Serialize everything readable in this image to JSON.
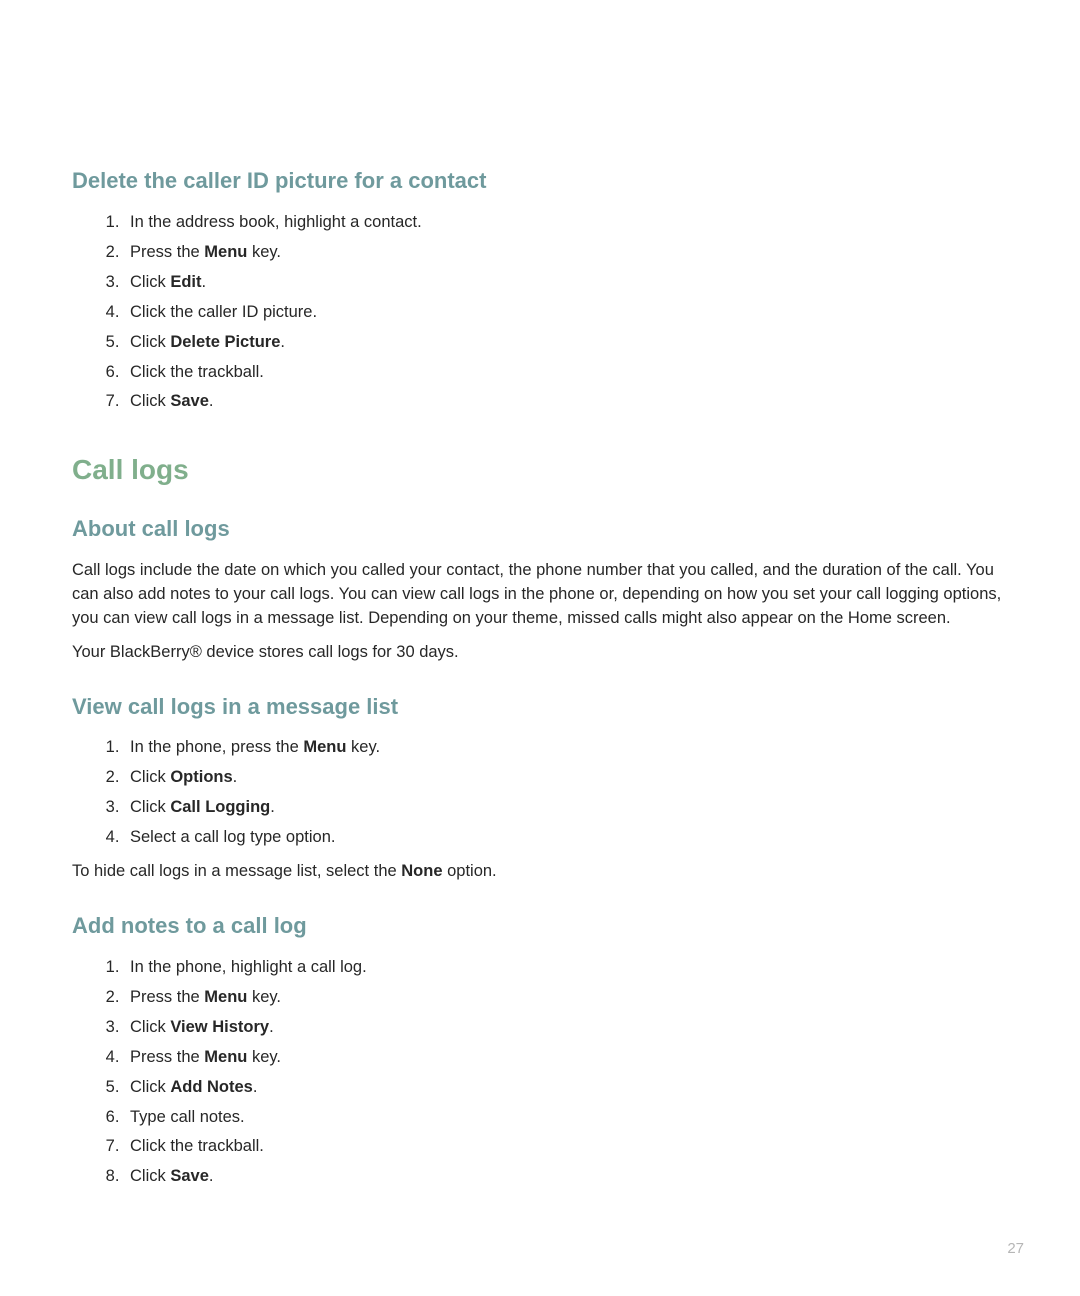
{
  "page_number": "27",
  "section1": {
    "heading": "Delete the caller ID picture for a contact",
    "steps": [
      [
        {
          "t": "In the address book, highlight a contact."
        }
      ],
      [
        {
          "t": "Press the "
        },
        {
          "t": "Menu",
          "b": true
        },
        {
          "t": " key."
        }
      ],
      [
        {
          "t": "Click "
        },
        {
          "t": "Edit",
          "b": true
        },
        {
          "t": "."
        }
      ],
      [
        {
          "t": "Click the caller ID picture."
        }
      ],
      [
        {
          "t": "Click "
        },
        {
          "t": "Delete Picture",
          "b": true
        },
        {
          "t": "."
        }
      ],
      [
        {
          "t": "Click the trackball."
        }
      ],
      [
        {
          "t": "Click "
        },
        {
          "t": "Save",
          "b": true
        },
        {
          "t": "."
        }
      ]
    ]
  },
  "section2": {
    "heading": "Call logs"
  },
  "section3": {
    "heading": "About call logs",
    "paragraphs": [
      [
        {
          "t": "Call logs include the date on which you called your contact, the phone number that you called, and the duration of the call. You can also add notes to your call logs. You can view call logs in the phone or, depending on how you set your call logging options, you can view call logs in a message list. Depending on your theme, missed calls might also appear on the Home screen."
        }
      ],
      [
        {
          "t": "Your BlackBerry® device stores call logs for 30 days."
        }
      ]
    ]
  },
  "section4": {
    "heading": "View call logs in a message list",
    "steps": [
      [
        {
          "t": "In the phone, press the "
        },
        {
          "t": "Menu",
          "b": true
        },
        {
          "t": " key."
        }
      ],
      [
        {
          "t": "Click "
        },
        {
          "t": "Options",
          "b": true
        },
        {
          "t": "."
        }
      ],
      [
        {
          "t": "Click "
        },
        {
          "t": "Call Logging",
          "b": true
        },
        {
          "t": "."
        }
      ],
      [
        {
          "t": "Select a call log type option."
        }
      ]
    ],
    "after": [
      {
        "t": "To hide call logs in a message list, select the "
      },
      {
        "t": "None",
        "b": true
      },
      {
        "t": " option."
      }
    ]
  },
  "section5": {
    "heading": "Add notes to a call log",
    "steps": [
      [
        {
          "t": "In the phone, highlight a call log."
        }
      ],
      [
        {
          "t": "Press the "
        },
        {
          "t": "Menu",
          "b": true
        },
        {
          "t": " key."
        }
      ],
      [
        {
          "t": "Click "
        },
        {
          "t": "View History",
          "b": true
        },
        {
          "t": "."
        }
      ],
      [
        {
          "t": "Press the "
        },
        {
          "t": "Menu",
          "b": true
        },
        {
          "t": " key."
        }
      ],
      [
        {
          "t": "Click "
        },
        {
          "t": "Add Notes",
          "b": true
        },
        {
          "t": "."
        }
      ],
      [
        {
          "t": "Type call notes."
        }
      ],
      [
        {
          "t": "Click the trackball."
        }
      ],
      [
        {
          "t": "Click "
        },
        {
          "t": "Save",
          "b": true
        },
        {
          "t": "."
        }
      ]
    ]
  }
}
